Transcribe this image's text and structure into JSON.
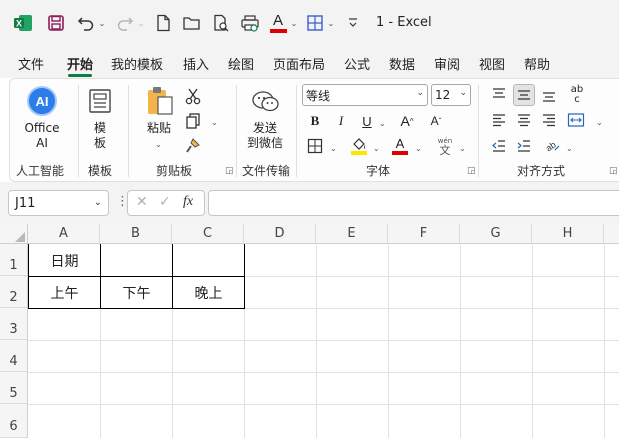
{
  "window": {
    "title": "1  -  Excel",
    "app_icon": "excel-logo-icon",
    "accent": "#107c41"
  },
  "quick_access": {
    "save": "save-icon",
    "undo": "undo-icon",
    "redo": "redo-icon",
    "new": "new-file-icon",
    "open": "open-folder-icon",
    "print_preview": "print-preview-icon",
    "print": "print-icon",
    "font_color": "font-color-icon",
    "borders": "borders-icon",
    "customize": "customize-icon"
  },
  "menu": {
    "tabs": [
      "文件",
      "开始",
      "我的模板",
      "插入",
      "绘图",
      "页面布局",
      "公式",
      "数据",
      "审阅",
      "视图",
      "帮助"
    ],
    "active": "开始"
  },
  "ribbon": {
    "groups": {
      "ai": {
        "label": "人工智能",
        "button": "Office\nAI",
        "button_l1": "Office",
        "button_l2": "AI"
      },
      "template": {
        "label": "模板",
        "button_l1": "模",
        "button_l2": "板"
      },
      "clipboard": {
        "label": "剪贴板",
        "paste": "粘贴"
      },
      "file_transfer": {
        "label": "文件传输",
        "button_l1": "发送",
        "button_l2": "到微信"
      },
      "font": {
        "label": "字体",
        "font_name": "等线",
        "font_size": "12",
        "bold": "B",
        "italic": "I",
        "underline": "U",
        "grow": "A",
        "shrink": "A",
        "font_color": "A",
        "phonetic_top": "wén",
        "phonetic_bottom": "文",
        "highlight_color": "#ffe600",
        "font_color_value": "#e00000"
      },
      "alignment": {
        "label": "对齐方式",
        "wrap_top": "ab",
        "wrap_bottom": "c"
      }
    }
  },
  "formula_bar": {
    "name_box": "J11",
    "formula": "",
    "fx": "fx"
  },
  "sheet": {
    "columns": [
      "A",
      "B",
      "C",
      "D",
      "E",
      "F",
      "G",
      "H"
    ],
    "rows": [
      "1",
      "2",
      "3",
      "4",
      "5",
      "6"
    ],
    "cells": {
      "A1": "日期",
      "B1": "",
      "C1": "",
      "A2": "上午",
      "B2": "下午",
      "C2": "晚上"
    }
  }
}
